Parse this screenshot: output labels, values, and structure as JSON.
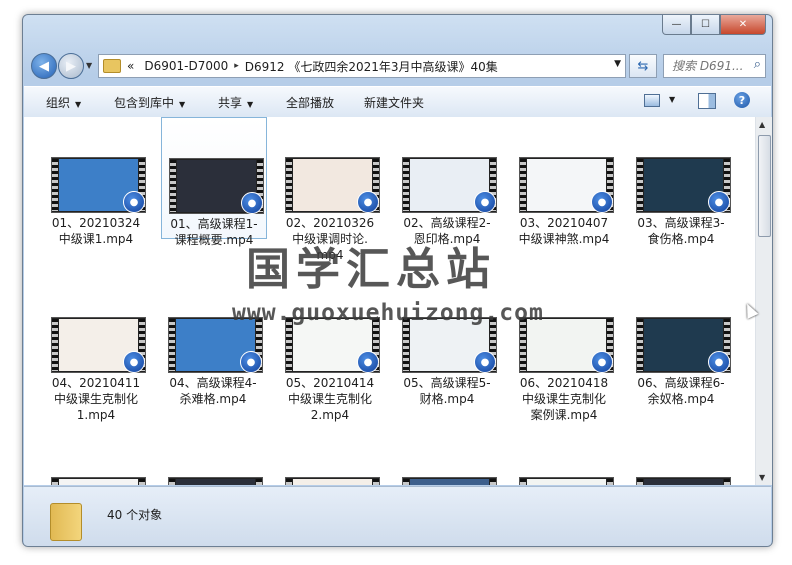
{
  "titlebar": {
    "min_glyph": "—",
    "max_glyph": "☐",
    "close_glyph": "✕"
  },
  "address": {
    "overflow_glyph": "«",
    "crumbs": [
      "D6901-D7000",
      "D6912 《七政四余2021年3月中高级课》40集"
    ],
    "sep_glyph": "▸"
  },
  "search": {
    "placeholder": "搜索 D691..."
  },
  "toolbar": {
    "organize": "组织",
    "include": "包含到库中",
    "share": "共享",
    "play_all": "全部播放",
    "new_folder": "新建文件夹"
  },
  "files": [
    {
      "l1": "01、20210324",
      "l2": "中级课1.mp4",
      "l3": "",
      "screen": "#3d7fc8"
    },
    {
      "l1": "01、高级课程1-",
      "l2": "课程概要.mp4",
      "l3": "",
      "screen": "#2b2f3a",
      "selected": true
    },
    {
      "l1": "02、20210326",
      "l2": "中级课调时论.",
      "l3": "mp4",
      "screen": "#f2e8e0"
    },
    {
      "l1": "02、高级课程2-",
      "l2": "恩印格.mp4",
      "l3": "",
      "screen": "#e9eef4"
    },
    {
      "l1": "03、20210407",
      "l2": "中级课神煞.mp4",
      "l3": "",
      "screen": "#f4f6f8"
    },
    {
      "l1": "03、高级课程3-",
      "l2": "食伤格.mp4",
      "l3": "",
      "screen": "#1f3a4f"
    },
    {
      "l1": "04、20210411",
      "l2": "中级课生克制化",
      "l3": "1.mp4",
      "screen": "#f4efe9"
    },
    {
      "l1": "04、高级课程4-",
      "l2": "杀难格.mp4",
      "l3": "",
      "screen": "#3d7fc8"
    },
    {
      "l1": "05、20210414",
      "l2": "中级课生克制化",
      "l3": "2.mp4",
      "screen": "#f5f7f5"
    },
    {
      "l1": "05、高级课程5-",
      "l2": "财格.mp4",
      "l3": "",
      "screen": "#eef2f4"
    },
    {
      "l1": "06、20210418",
      "l2": "中级课生克制化",
      "l3": "案例课.mp4",
      "screen": "#f2f4f2"
    },
    {
      "l1": "06、高级课程6-",
      "l2": "余奴格.mp4",
      "l3": "",
      "screen": "#1f3a4f"
    },
    {
      "l1": "",
      "l2": "",
      "l3": "",
      "screen": "#f4f4f4"
    },
    {
      "l1": "",
      "l2": "",
      "l3": "",
      "screen": "#2b2f3a"
    },
    {
      "l1": "",
      "l2": "",
      "l3": "",
      "screen": "#f4efe9"
    },
    {
      "l1": "",
      "l2": "",
      "l3": "",
      "screen": "#3d5f8c"
    },
    {
      "l1": "",
      "l2": "",
      "l3": "",
      "screen": "#f2f4f2"
    },
    {
      "l1": "",
      "l2": "",
      "l3": "",
      "screen": "#2b2f3a"
    }
  ],
  "watermark": {
    "cn": "国学汇总站",
    "url": "www.guoxuehuizong.com"
  },
  "status": {
    "count": "40 个对象"
  },
  "colors": {
    "accent": "#2461b5",
    "selection": "#86b5da"
  }
}
